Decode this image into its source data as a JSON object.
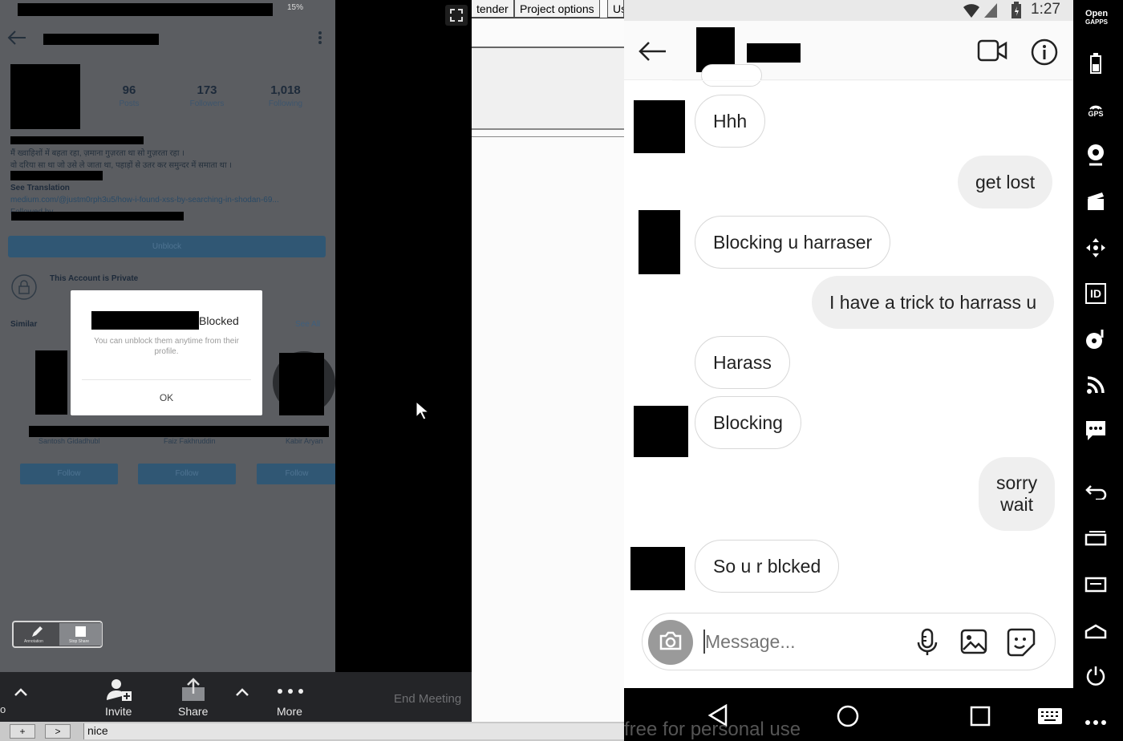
{
  "left_profile": {
    "stats": [
      {
        "value": "96",
        "label": "Posts"
      },
      {
        "value": "173",
        "label": "Followers"
      },
      {
        "value": "1,018",
        "label": "Following"
      }
    ],
    "status_battery": "15%",
    "bio_line1": "मैं ख्वाहिशों में बहता रहा, ज़माना गुज़रता था सो गुज़रता रहा ।",
    "bio_line2": "वो दरिया सा था जो उसे ले जाता था, पहाड़ों से उतर कर समुन्दर में समाता था ।",
    "see_translation": "See Translation",
    "link": "medium.com/@justm0rph3u5/how-i-found-xss-by-searching-in-shodan-69...",
    "followed_by": "Followed by",
    "unblock_label": "Unblock",
    "private_label": "This Account is Private",
    "similar_label": "Similar",
    "see_all_label": "See All",
    "suggestions": [
      {
        "name": "Santosh Gidadhubl",
        "follow": "Follow"
      },
      {
        "name": "Faiz Fakhruddin",
        "follow": "Follow"
      },
      {
        "name": "Kabir Aryan",
        "follow": "Follow"
      }
    ]
  },
  "dialog": {
    "title_suffix": "Blocked",
    "message": "You can unblock them anytime from their profile.",
    "ok_label": "OK"
  },
  "annotation_tool": {
    "annotate_label": "Annotation",
    "stop_label": "Stop Share"
  },
  "zoom_bar": {
    "invite_label": "Invite",
    "share_label": "Share",
    "more_label": "More",
    "end_meeting_label": "End Meeting"
  },
  "status_strip": {
    "plus_label": "+",
    "next_label": ">",
    "text": "nice"
  },
  "menu_tabs": [
    "tender",
    "Project options",
    "Us"
  ],
  "phone": {
    "time": "1:27",
    "messages": [
      {
        "text": "Hhh",
        "dir": "in"
      },
      {
        "text": "get lost",
        "dir": "out"
      },
      {
        "text": "Blocking u harraser",
        "dir": "in"
      },
      {
        "text": "I have a trick to harrass u",
        "dir": "out"
      },
      {
        "text": "Harass",
        "dir": "in"
      },
      {
        "text": "Blocking",
        "dir": "in"
      },
      {
        "text": "sorry\nwait",
        "dir": "out"
      },
      {
        "text": "So u r blcked",
        "dir": "in"
      }
    ],
    "composer_placeholder": "Message..."
  },
  "watermark": "free for personal use",
  "side_toolbar": {
    "brand_line1": "Open",
    "brand_line2": "GAPPS",
    "gps_label": "GPS",
    "id_label": "ID"
  },
  "icons": {
    "back": "arrow-left-icon",
    "video": "video-camera-icon",
    "info": "info-icon",
    "camera": "camera-icon",
    "mic": "microphone-icon",
    "gallery": "image-icon",
    "sticker": "sticker-icon"
  },
  "colors": {
    "dimmed_overlay": "#5b5d61",
    "unblock_button": "#305774",
    "outgoing_bubble": "#efefef",
    "camera_button": "#9a9a9a"
  }
}
